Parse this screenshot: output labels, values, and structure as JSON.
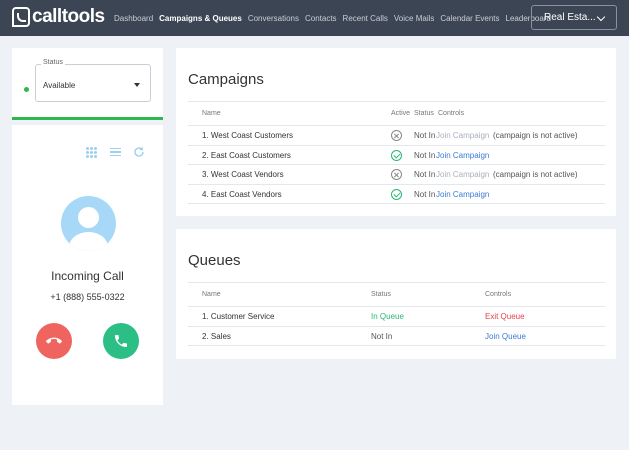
{
  "brand": {
    "logo_text": "calltools"
  },
  "nav": {
    "items": [
      {
        "label": "Dashboard",
        "active": false
      },
      {
        "label": "Campaigns & Queues",
        "active": true
      },
      {
        "label": "Conversations",
        "active": false
      },
      {
        "label": "Contacts",
        "active": false
      },
      {
        "label": "Recent Calls",
        "active": false
      },
      {
        "label": "Voice Mails",
        "active": false
      },
      {
        "label": "Calendar Events",
        "active": false
      },
      {
        "label": "Leaderboard",
        "active": false
      }
    ],
    "account_label": "Real Esta..."
  },
  "status": {
    "label": "Status",
    "value": "Available",
    "indicator_color": "#2db84d"
  },
  "call": {
    "title": "Incoming Call",
    "number": "+1 (888) 555-0322",
    "decline_color": "#f0645f",
    "answer_color": "#2bbf85"
  },
  "campaigns": {
    "title": "Campaigns",
    "headers": {
      "name": "Name",
      "active": "Active",
      "status": "Status",
      "controls": "Controls"
    },
    "rows": [
      {
        "name": "1. West Coast Customers",
        "active_icon": "x-circle-icon",
        "status": "Not In",
        "control": "Join Campaign",
        "control_enabled": false,
        "note": "(campaign is not active)"
      },
      {
        "name": "2. East Coast Customers",
        "active_icon": "check-circle-icon",
        "status": "Not In",
        "control": "Join Campaign",
        "control_enabled": true,
        "note": ""
      },
      {
        "name": "3. West Coast Vendors",
        "active_icon": "x-circle-icon",
        "status": "Not In",
        "control": "Join Campaign",
        "control_enabled": false,
        "note": "(campaign is not active)"
      },
      {
        "name": "4. East Coast Vendors",
        "active_icon": "check-circle-icon",
        "status": "Not In",
        "control": "Join Campaign",
        "control_enabled": true,
        "note": ""
      }
    ]
  },
  "queues": {
    "title": "Queues",
    "headers": {
      "name": "Name",
      "status": "Status",
      "controls": "Controls"
    },
    "rows": [
      {
        "name": "1. Customer Service",
        "status": "In Queue",
        "control": "Exit Queue"
      },
      {
        "name": "2. Sales",
        "status": "Not In",
        "control": "Join Queue"
      }
    ]
  }
}
